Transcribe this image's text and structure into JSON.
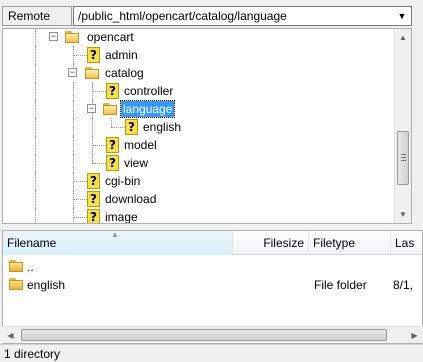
{
  "site_bar": {
    "label": "Remote site:",
    "path": "/public_html/opencart/catalog/language",
    "dropdown_icon": "chevron-down-icon"
  },
  "tree": {
    "items": [
      {
        "label": "opencart",
        "icon": "folder-open-icon",
        "toggle": "−"
      },
      {
        "label": "admin",
        "icon": "unknown-folder-icon"
      },
      {
        "label": "catalog",
        "icon": "folder-open-icon",
        "toggle": "−"
      },
      {
        "label": "controller",
        "icon": "unknown-folder-icon"
      },
      {
        "label": "language",
        "icon": "folder-open-icon",
        "toggle": "−",
        "selected": true
      },
      {
        "label": "english",
        "icon": "unknown-folder-icon"
      },
      {
        "label": "model",
        "icon": "unknown-folder-icon"
      },
      {
        "label": "view",
        "icon": "unknown-folder-icon"
      },
      {
        "label": "cgi-bin",
        "icon": "unknown-folder-icon"
      },
      {
        "label": "download",
        "icon": "unknown-folder-icon"
      },
      {
        "label": "image",
        "icon": "unknown-folder-icon"
      }
    ],
    "selection_color": "#3399ff"
  },
  "file_list": {
    "columns": [
      "Filename",
      "Filesize",
      "Filetype",
      "Las"
    ],
    "rows": [
      {
        "name": "..",
        "type": "",
        "modified": ""
      },
      {
        "name": "english",
        "type": "File folder",
        "modified": "8/1,"
      }
    ]
  },
  "status": {
    "text": "1 directory"
  }
}
